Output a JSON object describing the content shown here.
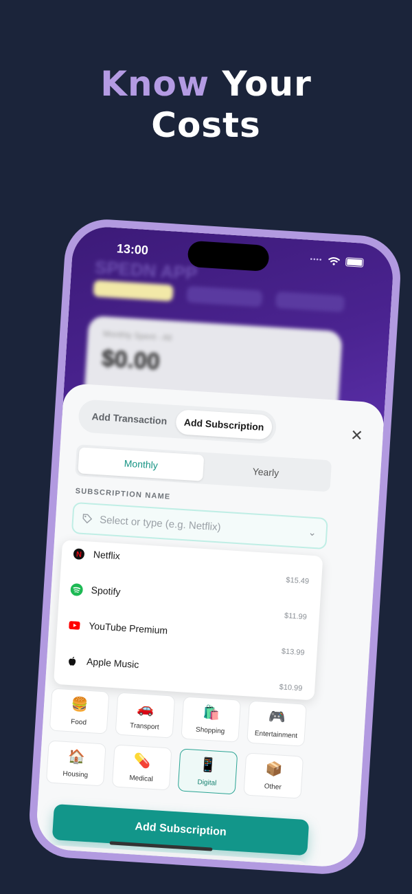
{
  "headline": {
    "accent": "Know",
    "rest_line1": "Your",
    "line2": "Costs"
  },
  "status_bar": {
    "time": "13:00"
  },
  "background_app": {
    "title": "SPEDN APP",
    "amount": "$0.00",
    "card_label": "Monthly Spent - All"
  },
  "sheet": {
    "type_tabs": [
      "Add Transaction",
      "Add Subscription"
    ],
    "active_type": "Add Subscription",
    "period_tabs": [
      "Monthly",
      "Yearly"
    ],
    "active_period": "Monthly",
    "field_label": "SUBSCRIPTION NAME",
    "name_placeholder": "Select or type (e.g. Netflix)",
    "subscriptions": [
      {
        "name": "Netflix",
        "price": "$15.49",
        "icon": "netflix-icon",
        "color": "#e50914"
      },
      {
        "name": "Spotify",
        "price": "$11.99",
        "icon": "spotify-icon",
        "color": "#1db954"
      },
      {
        "name": "YouTube Premium",
        "price": "$13.99",
        "icon": "youtube-icon",
        "color": "#ff0000"
      },
      {
        "name": "Apple Music",
        "price": "$10.99",
        "icon": "apple-icon",
        "color": "#000000"
      }
    ],
    "categories": [
      {
        "label": "Food",
        "emoji": "🍔"
      },
      {
        "label": "Transport",
        "emoji": "🚗"
      },
      {
        "label": "Shopping",
        "emoji": "🛍️"
      },
      {
        "label": "Entertainment",
        "emoji": "🎮"
      },
      {
        "label": "Housing",
        "emoji": "🏠"
      },
      {
        "label": "Medical",
        "emoji": "💊"
      },
      {
        "label": "Digital",
        "emoji": "📱"
      },
      {
        "label": "Other",
        "emoji": "📦"
      }
    ],
    "selected_category": "Digital",
    "submit_label": "Add Subscription"
  },
  "colors": {
    "background": "#1b243a",
    "accent_purple": "#b49be3",
    "teal": "#12968a"
  }
}
